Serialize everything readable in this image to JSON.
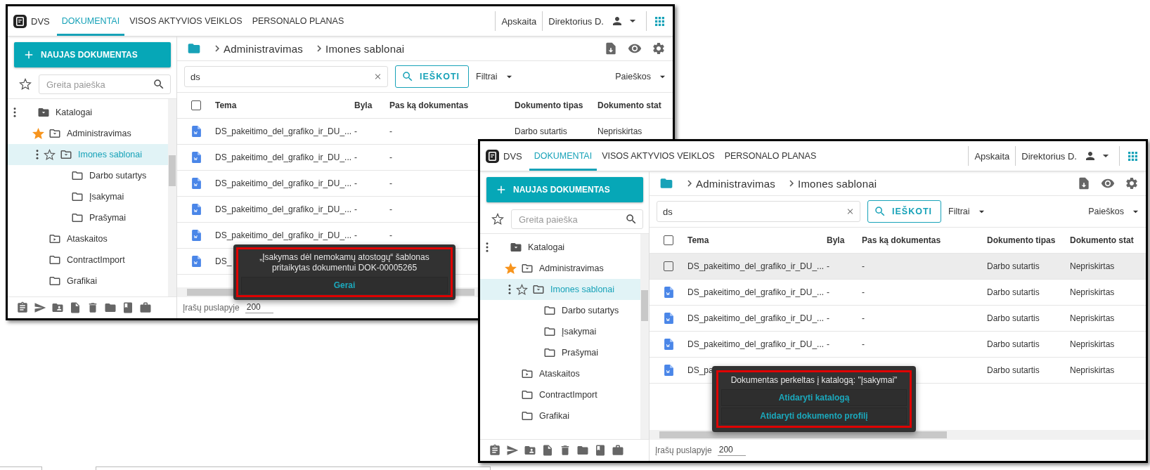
{
  "windows": [
    {
      "nav": {
        "brand": "DVS",
        "tabs": [
          {
            "label": "DOKUMENTAI",
            "selected": true
          },
          {
            "label": "VISOS AKTYVIOS VEIKLOS",
            "selected": false
          },
          {
            "label": "PERSONALO PLANAS",
            "selected": false
          }
        ],
        "company": "Apskaita",
        "user": "Direktorius D."
      },
      "sidebar": {
        "new_button": "NAUJAS DOKUMENTAS",
        "search": {
          "placeholder": "Greita paieška"
        },
        "tree": [
          {
            "label": "Katalogai",
            "kind": "catalog",
            "menu": true,
            "selected": false,
            "children": [
              {
                "label": "Administravimas",
                "kind": "folder-menu",
                "starred": true,
                "selected": false,
                "children": [
                  {
                    "label": "Imones sablonai",
                    "kind": "folder-menu",
                    "starred": false,
                    "menu": true,
                    "selected": true,
                    "children": [
                      {
                        "label": "Darbo sutartys",
                        "kind": "folder",
                        "selected": false
                      },
                      {
                        "label": "Įsakymai",
                        "kind": "folder",
                        "selected": false
                      },
                      {
                        "label": "Prašymai",
                        "kind": "folder",
                        "selected": false
                      }
                    ]
                  }
                ]
              },
              {
                "label": "Ataskaitos",
                "kind": "folder-play",
                "selected": false
              },
              {
                "label": "ContractImport",
                "kind": "folder",
                "selected": false
              },
              {
                "label": "Grafikai",
                "kind": "folder",
                "selected": false
              }
            ]
          }
        ]
      },
      "breadcrumb": [
        "Administravimas",
        "Imones sablonai"
      ],
      "search": {
        "value": "ds",
        "button": "IEŠKOTI",
        "filters": "Filtrai",
        "saved": "Paieškos"
      },
      "table": {
        "select_all": {
          "checked": false
        },
        "columns": [
          "Tema",
          "Byla",
          "Pas ką dokumentas",
          "Dokumento tipas",
          "Dokumento stat"
        ],
        "rows": [
          {
            "hovered": false,
            "tema": "DS_pakeitimo_del_grafiko_ir_DU_...",
            "byla": "-",
            "pas_ka": "-",
            "tipas": "Darbo sutartis",
            "column_5": "Nepriskirtas"
          },
          {
            "hovered": false,
            "tema": "DS_pakeitimo_del_grafiko_ir_DU_...",
            "byla": "-",
            "pas_ka": "-"
          },
          {
            "hovered": false,
            "tema": "DS_pakeitimo_del_grafiko_ir_DU_...",
            "byla": "-",
            "pas_ka": "-"
          },
          {
            "hovered": false,
            "tema": "DS_pakeitimo_del_grafiko_ir_DU_...",
            "byla": "-",
            "pas_ka": "-"
          },
          {
            "hovered": false,
            "tema": "DS_pakeitimo_del_grafiko_ir_DU_...",
            "byla": "-",
            "pas_ka": "-"
          },
          {
            "hovered": false,
            "tema": "DS_"
          }
        ]
      },
      "footer": {
        "rows_per_page_label": "Įrašų puslapyje",
        "rows_per_page": "200"
      },
      "toast": {
        "message": "„Įsakymas dėl nemokamų atostogų“ šablonas pritaikytas dokumentui DOK-00005265",
        "actions": [
          "Gerai"
        ]
      }
    },
    {
      "nav": {
        "brand": "DVS",
        "tabs": [
          {
            "label": "DOKUMENTAI",
            "selected": true
          },
          {
            "label": "VISOS AKTYVIOS VEIKLOS",
            "selected": false
          },
          {
            "label": "PERSONALO PLANAS",
            "selected": false
          }
        ],
        "company": "Apskaita",
        "user": "Direktorius D."
      },
      "sidebar": {
        "new_button": "NAUJAS DOKUMENTAS",
        "search": {
          "placeholder": "Greita paieška"
        },
        "tree": [
          {
            "label": "Katalogai",
            "kind": "catalog",
            "menu": true,
            "selected": false,
            "children": [
              {
                "label": "Administravimas",
                "kind": "folder-menu",
                "starred": true,
                "selected": false,
                "children": [
                  {
                    "label": "Imones sablonai",
                    "kind": "folder-menu",
                    "starred": false,
                    "menu": true,
                    "selected": true,
                    "children": [
                      {
                        "label": "Darbo sutartys",
                        "kind": "folder",
                        "selected": false
                      },
                      {
                        "label": "Įsakymai",
                        "kind": "folder",
                        "selected": false
                      },
                      {
                        "label": "Prašymai",
                        "kind": "folder",
                        "selected": false
                      }
                    ]
                  }
                ]
              },
              {
                "label": "Ataskaitos",
                "kind": "folder-play",
                "selected": false
              },
              {
                "label": "ContractImport",
                "kind": "folder",
                "selected": false
              },
              {
                "label": "Grafikai",
                "kind": "folder",
                "selected": false
              }
            ]
          }
        ]
      },
      "breadcrumb": [
        "Administravimas",
        "Imones sablonai"
      ],
      "search": {
        "value": "ds",
        "button": "IEŠKOTI",
        "filters": "Filtrai",
        "saved": "Paieškos"
      },
      "table": {
        "select_all": {
          "checked": false
        },
        "columns": [
          "Tema",
          "Byla",
          "Pas ką dokumentas",
          "Dokumento tipas",
          "Dokumento stat"
        ],
        "rows": [
          {
            "hovered": true,
            "tema": "DS_pakeitimo_del_grafiko_ir_DU_...",
            "byla": "-",
            "pas_ka": "-",
            "tipas": "Darbo sutartis",
            "column_5": "Nepriskirtas"
          },
          {
            "hovered": false,
            "tema": "DS_pakeitimo_del_grafiko_ir_DU_...",
            "byla": "-",
            "pas_ka": "-",
            "tipas": "Darbo sutartis",
            "column_5": "Nepriskirtas"
          },
          {
            "hovered": false,
            "tema": "DS_pakeitimo_del_grafiko_ir_DU_...",
            "byla": "-",
            "pas_ka": "-",
            "tipas": "Darbo sutartis",
            "column_5": "Nepriskirtas"
          },
          {
            "hovered": false,
            "tema": "DS_pakeitimo_del_grafiko_ir_DU_...",
            "byla": "-",
            "pas_ka": "-",
            "tipas": "Darbo sutartis",
            "column_5": "Nepriskirtas"
          },
          {
            "hovered": false,
            "tema": "DS_pa",
            "tipas": "Darbo sutartis",
            "column_5": "Nepriskirtas"
          }
        ]
      },
      "footer": {
        "rows_per_page_label": "Įrašų puslapyje",
        "rows_per_page": "200"
      },
      "toast": {
        "message": "Dokumentas perkeltas į katalogą: \"Įsakymai\"",
        "actions": [
          "Atidaryti katalogą",
          "Atidaryti dokumento profilį"
        ]
      }
    }
  ]
}
